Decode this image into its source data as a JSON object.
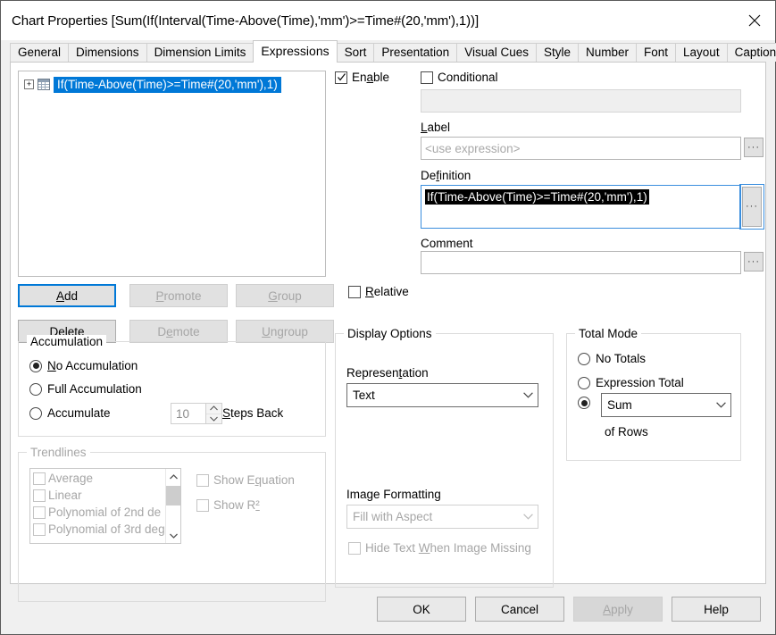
{
  "window": {
    "title": "Chart Properties [Sum(If(Interval(Time-Above(Time),'mm')>=Time#(20,'mm'),1))]",
    "close_icon": "close-icon"
  },
  "tabs": [
    {
      "label": "General",
      "active": false
    },
    {
      "label": "Dimensions",
      "active": false
    },
    {
      "label": "Dimension Limits",
      "active": false
    },
    {
      "label": "Expressions",
      "active": true
    },
    {
      "label": "Sort",
      "active": false
    },
    {
      "label": "Presentation",
      "active": false
    },
    {
      "label": "Visual Cues",
      "active": false
    },
    {
      "label": "Style",
      "active": false
    },
    {
      "label": "Number",
      "active": false
    },
    {
      "label": "Font",
      "active": false
    },
    {
      "label": "Layout",
      "active": false
    },
    {
      "label": "Caption",
      "active": false
    }
  ],
  "expression_tree": {
    "selected_item": "If(Time-Above(Time)>=Time#(20,'mm'),1)",
    "expander": "+",
    "selection_color": "#0078d7"
  },
  "list_buttons": {
    "add": "Add",
    "promote": "Promote",
    "group": "Group",
    "delete": "Delete",
    "demote": "Demote",
    "ungroup": "Ungroup"
  },
  "expression_props": {
    "enable_label": "Enable",
    "enable_checked": true,
    "conditional_label": "Conditional",
    "conditional_checked": false,
    "conditional_value": "",
    "label_caption": "Label",
    "label_placeholder": "<use expression>",
    "label_value": "",
    "definition_caption": "Definition",
    "definition_value": "If(Time-Above(Time)>=Time#(20,'mm'),1)",
    "comment_caption": "Comment",
    "comment_value": "",
    "relative_label": "Relative",
    "relative_checked": false,
    "ellipsis_glyph": "···"
  },
  "accumulation": {
    "title": "Accumulation",
    "options": [
      {
        "label": "No Accumulation",
        "selected": true
      },
      {
        "label": "Full Accumulation",
        "selected": false
      },
      {
        "label": "Accumulate",
        "selected": false
      }
    ],
    "steps_value": "10",
    "steps_label": "Steps Back"
  },
  "trendlines": {
    "title": "Trendlines",
    "enabled": false,
    "items": [
      {
        "label": "Average",
        "checked": false
      },
      {
        "label": "Linear",
        "checked": false
      },
      {
        "label": "Polynomial of 2nd de",
        "checked": false
      },
      {
        "label": "Polynomial of 3rd deg",
        "checked": false
      }
    ],
    "show_equation": "Show Equation",
    "show_equation_checked": false,
    "show_r2": "Show R²",
    "show_r2_checked": false,
    "scroll_up_icon": "chevron-up-icon",
    "scroll_down_icon": "chevron-down-icon"
  },
  "display_options": {
    "title": "Display Options",
    "representation_label": "Representation",
    "representation_value": "Text",
    "image_formatting_label": "Image Formatting",
    "image_formatting_value": "Fill with Aspect",
    "image_formatting_enabled": false,
    "hide_text_label": "Hide Text When Image Missing",
    "hide_text_checked": false,
    "hide_text_enabled": false,
    "chevron_icon": "chevron-down-icon"
  },
  "total_mode": {
    "title": "Total Mode",
    "options": [
      {
        "label": "No Totals",
        "selected": false
      },
      {
        "label": "Expression Total",
        "selected": false
      }
    ],
    "sum_selected": true,
    "sum_value": "Sum",
    "of_rows_label": "of Rows",
    "chevron_icon": "chevron-down-icon"
  },
  "footer": {
    "ok": "OK",
    "cancel": "Cancel",
    "apply": "Apply",
    "apply_enabled": false,
    "help": "Help"
  }
}
